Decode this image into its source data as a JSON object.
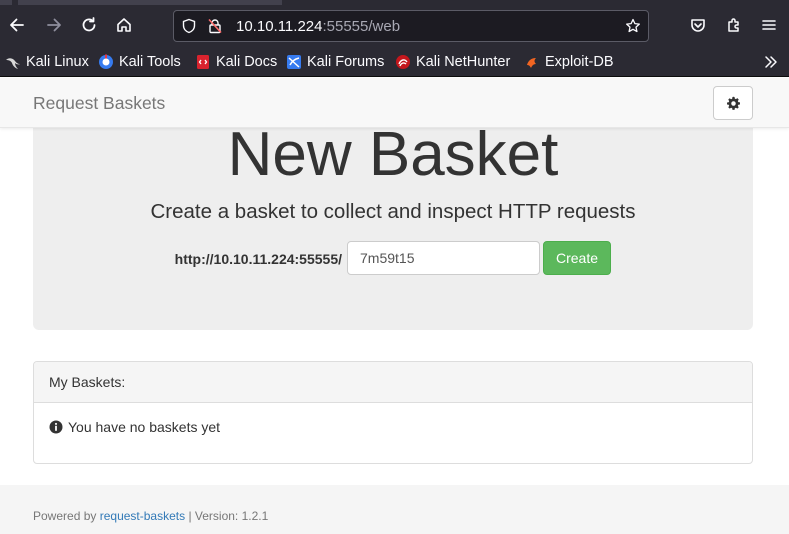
{
  "browser": {
    "url_host": "10.10.11.224",
    "url_rest": ":55555/web",
    "bookmarks": [
      {
        "label": "Kali Linux",
        "icon": "kali-dragon-icon"
      },
      {
        "label": "Kali Tools",
        "icon": "kali-tools-icon"
      },
      {
        "label": "Kali Docs",
        "icon": "kali-docs-icon"
      },
      {
        "label": "Kali Forums",
        "icon": "kali-forums-icon"
      },
      {
        "label": "Kali NetHunter",
        "icon": "kali-nethunter-icon"
      },
      {
        "label": "Exploit-DB",
        "icon": "exploit-db-icon"
      }
    ]
  },
  "navbar": {
    "brand": "Request Baskets",
    "settings_icon": "gear-icon"
  },
  "jumbotron": {
    "title": "New Basket",
    "subtitle": "Create a basket to collect and inspect HTTP requests",
    "url_prefix": "http://10.10.11.224:55555/",
    "basket_name": "7m59t15",
    "create_label": "Create"
  },
  "baskets_panel": {
    "heading": "My Baskets:",
    "empty_message": "You have no baskets yet"
  },
  "footer": {
    "powered_by": "Powered by",
    "link_text": "request-baskets",
    "version": "| Version: 1.2.1"
  },
  "colors": {
    "chrome": "#2b2a33",
    "success": "#5cb85c",
    "link": "#337ab7"
  }
}
